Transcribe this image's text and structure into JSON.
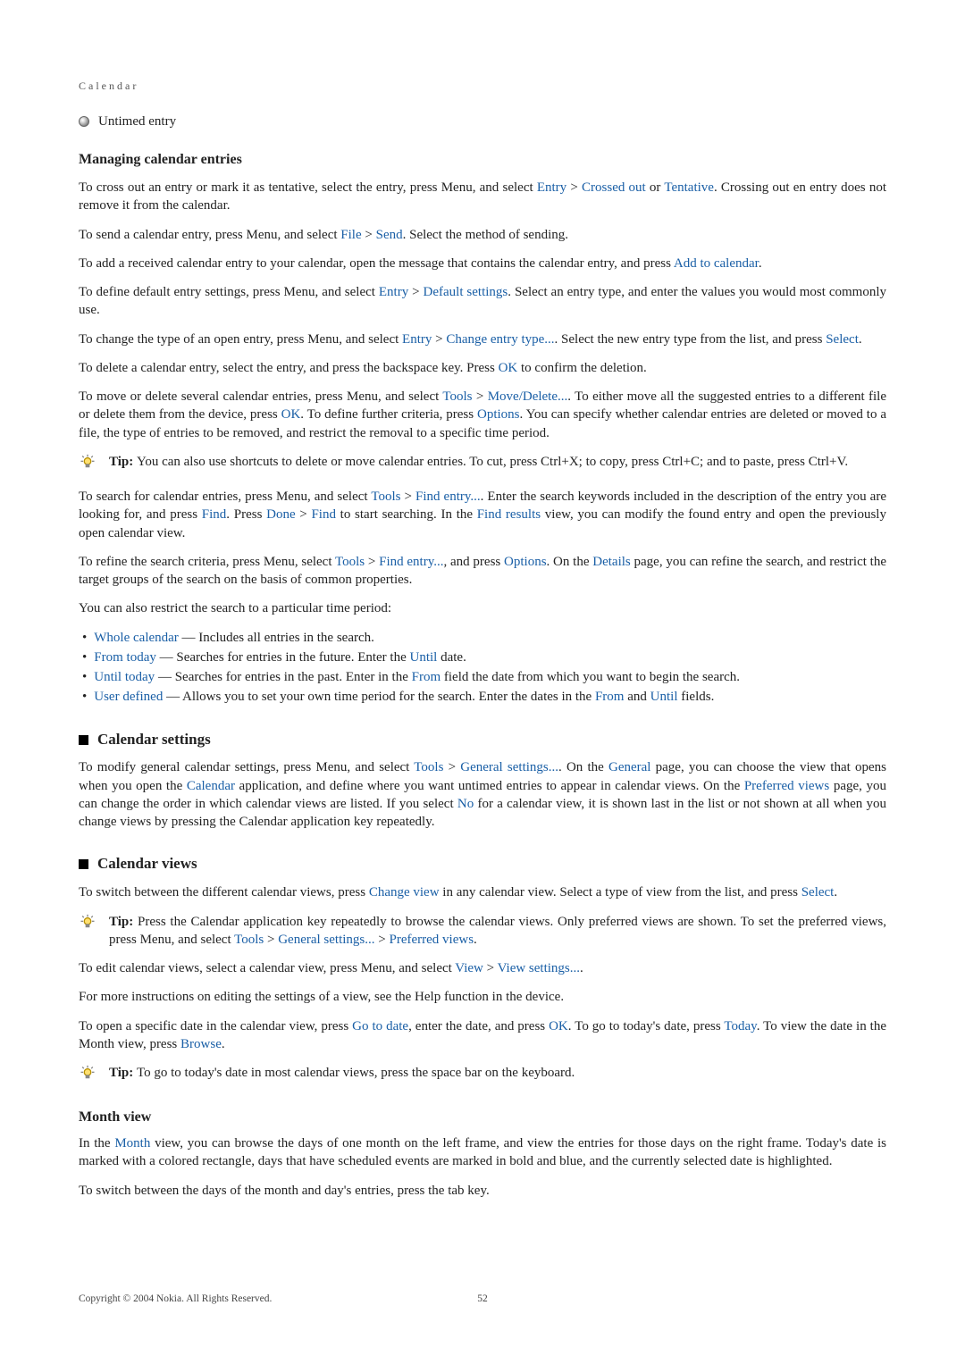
{
  "breadcrumb": "Calendar",
  "untimed": {
    "label": "Untimed entry"
  },
  "managing": {
    "title": "Managing calendar entries",
    "p1a": "To cross out an entry or mark it as tentative, select the entry, press Menu, and select ",
    "entry": "Entry",
    "gt": " > ",
    "crossed": "Crossed out",
    "or": " or ",
    "tentative": "Tentative",
    "p1b": ". Crossing out en entry does not remove it from the calendar.",
    "p2a": "To send a calendar entry, press Menu, and select ",
    "file": "File",
    "send": "Send",
    "p2b": ". Select the method of sending.",
    "p3a": "To add a received calendar entry to your calendar, open the message that contains the calendar entry, and press ",
    "addcal": "Add to calendar",
    "p3b": ".",
    "p4a": "To define default entry settings, press Menu, and select ",
    "defset": "Default settings",
    "p4b": ". Select an entry type, and enter the values you would most commonly use.",
    "p5a": "To change the type of an open entry, press Menu, and select ",
    "chtype": "Change entry type...",
    "p5b": ". Select the new entry type from the list, and press ",
    "select": "Select",
    "p5c": ".",
    "p6a": "To delete a calendar entry, select the entry, and press the backspace key. Press ",
    "ok": "OK",
    "p6b": " to confirm the deletion.",
    "p7a": "To move or delete several calendar entries, press Menu, and select ",
    "tools": "Tools",
    "movedel": "Move/Delete...",
    "p7b": ". To either move all the suggested entries to a different file or delete them from the device, press ",
    "p7c": ". To define further criteria, press ",
    "options": "Options",
    "p7d": ". You can specify whether calendar entries are deleted or moved to a file, the type of entries to be removed, and restrict the removal to a specific time period.",
    "tip1": {
      "bold": "Tip: ",
      "text": "You can also use shortcuts to delete or move calendar entries. To cut, press Ctrl+X; to copy, press Ctrl+C; and to paste, press Ctrl+V."
    },
    "p8a": "To search for calendar entries, press Menu, and select ",
    "findentry": "Find entry...",
    "p8b": ". Enter the search keywords included in the description of the entry you are looking for, and press ",
    "find": "Find",
    "p8c": ". Press ",
    "done": "Done",
    "p8d": " to start searching. In the ",
    "findres": "Find results",
    "p8e": " view, you can modify the found entry and open the previously open calendar view.",
    "p9a": "To refine the search criteria, press Menu, select ",
    "p9b": ", and press ",
    "p9c": ". On the ",
    "details": "Details",
    "p9d": " page, you can refine the search, and restrict the target groups of the search on the basis of common properties.",
    "p10": "You can also restrict the search to a particular time period:",
    "b1": {
      "t": "Whole calendar",
      "r": " — Includes all entries in the search."
    },
    "b2": {
      "t": "From today",
      "r1": " — Searches for entries in the future. Enter the ",
      "u": "Until",
      "r2": " date."
    },
    "b3": {
      "t": "Until today",
      "r1": " — Searches for entries in the past. Enter in the ",
      "f": "From",
      "r2": " field the date from which you want to begin the search."
    },
    "b4": {
      "t": "User defined",
      "r1": " — Allows you to set your own time period for the search. Enter the dates in the ",
      "f": "From",
      "and": " and ",
      "u": "Until",
      "r2": " fields."
    }
  },
  "settings": {
    "title": "Calendar settings",
    "p1a": "To modify general calendar settings, press Menu, and select ",
    "tools": "Tools",
    "gt": " > ",
    "gen": "General settings...",
    "p1b": ". On the ",
    "general": "General",
    "p1c": " page, you can choose the view that opens when you open the ",
    "calendar": "Calendar",
    "p1d": " application, and define where you want untimed entries to appear in calendar views. On the ",
    "pref": "Preferred views",
    "p1e": " page, you can change the order in which calendar views are listed. If you select ",
    "no": "No",
    "p1f": " for a calendar view, it is shown last in the list or not shown at all when you change views by pressing the Calendar application key repeatedly."
  },
  "views": {
    "title": "Calendar views",
    "p1a": "To switch between the different calendar views, press ",
    "chview": "Change view",
    "p1b": " in any calendar view. Select a type of view from the list, and press ",
    "select": "Select",
    "p1c": ".",
    "tip": {
      "bold": "Tip: ",
      "a": "Press the Calendar application key repeatedly to browse the calendar views. Only preferred views are shown. To set the preferred views, press Menu, and select ",
      "tools": "Tools",
      "gt": " > ",
      "gen": "General settings...",
      "pref": "Preferred views",
      "dot": "."
    },
    "p2a": "To edit calendar views, select a calendar view, press Menu, and select ",
    "view": "View",
    "vset": "View settings...",
    "p2b": ".",
    "p3": "For more instructions on editing the settings of a view, see the Help function in the device.",
    "p4a": "To open a specific date in the calendar view, press ",
    "goto": "Go to date",
    "p4b": ", enter the date, and press ",
    "ok": "OK",
    "p4c": ". To go to today's date, press ",
    "today": "Today",
    "p4d": ". To view the date in the Month view, press ",
    "browse": "Browse",
    "p4e": ".",
    "tip2": {
      "bold": "Tip: ",
      "text": "To go to today's date in most calendar views, press the space bar on the keyboard."
    }
  },
  "month": {
    "title": "Month view",
    "p1a": "In the ",
    "m": "Month",
    "p1b": " view, you can browse the days of one month on the left frame, and view the entries for those days on the right frame. Today's date is marked with a colored rectangle, days that have scheduled events are marked in bold and blue, and the currently selected date is highlighted.",
    "p2": "To switch between the days of the month and day's entries, press the tab key."
  },
  "footer": {
    "copyright": "Copyright © 2004 Nokia. All Rights Reserved.",
    "page": "52"
  }
}
